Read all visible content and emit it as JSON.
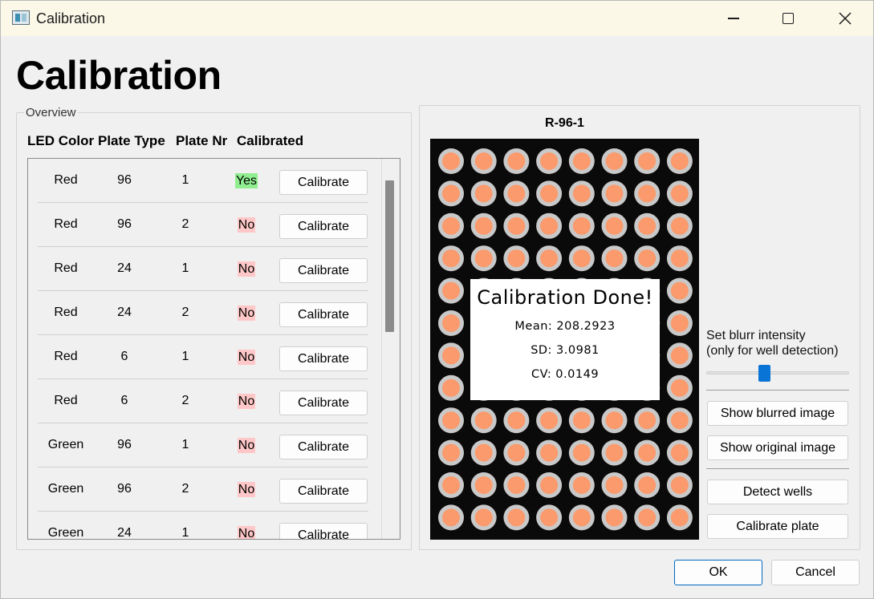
{
  "window": {
    "title": "Calibration"
  },
  "page": {
    "title": "Calibration"
  },
  "overview": {
    "legend": "Overview",
    "headers": {
      "led_color": "LED Color",
      "plate_type": "Plate Type",
      "plate_nr": "Plate Nr",
      "calibrated": "Calibrated"
    },
    "rows": [
      {
        "color": "Red",
        "type": "96",
        "nr": "1",
        "calibrated": "Yes",
        "button": "Calibrate"
      },
      {
        "color": "Red",
        "type": "96",
        "nr": "2",
        "calibrated": "No",
        "button": "Calibrate"
      },
      {
        "color": "Red",
        "type": "24",
        "nr": "1",
        "calibrated": "No",
        "button": "Calibrate"
      },
      {
        "color": "Red",
        "type": "24",
        "nr": "2",
        "calibrated": "No",
        "button": "Calibrate"
      },
      {
        "color": "Red",
        "type": "6",
        "nr": "1",
        "calibrated": "No",
        "button": "Calibrate"
      },
      {
        "color": "Red",
        "type": "6",
        "nr": "2",
        "calibrated": "No",
        "button": "Calibrate"
      },
      {
        "color": "Green",
        "type": "96",
        "nr": "1",
        "calibrated": "No",
        "button": "Calibrate"
      },
      {
        "color": "Green",
        "type": "96",
        "nr": "2",
        "calibrated": "No",
        "button": "Calibrate"
      },
      {
        "color": "Green",
        "type": "24",
        "nr": "1",
        "calibrated": "No",
        "button": "Calibrate"
      }
    ],
    "status_colors": {
      "yes": "#90ee90",
      "no": "#ffc7c7"
    }
  },
  "image_panel": {
    "label": "R-96-1",
    "plate": {
      "rows": 12,
      "cols": 8,
      "well_color": "#fb9a6c",
      "ring_color": "#c9c9c9",
      "background": "#0a0a0a"
    },
    "result": {
      "title": "Calibration Done!",
      "mean": "Mean: 208.2923",
      "sd": "SD: 3.0981",
      "cv": "CV: 0.0149"
    }
  },
  "controls": {
    "blur_label_line1": "Set blurr intensity",
    "blur_label_line2": "(only for well detection)",
    "blur_level": 0.4,
    "show_blurred": "Show blurred image",
    "show_original": "Show original image",
    "detect_wells": "Detect wells",
    "calibrate_plate": "Calibrate plate"
  },
  "dialog": {
    "ok": "OK",
    "cancel": "Cancel"
  },
  "accent_color": "#0a74d6"
}
